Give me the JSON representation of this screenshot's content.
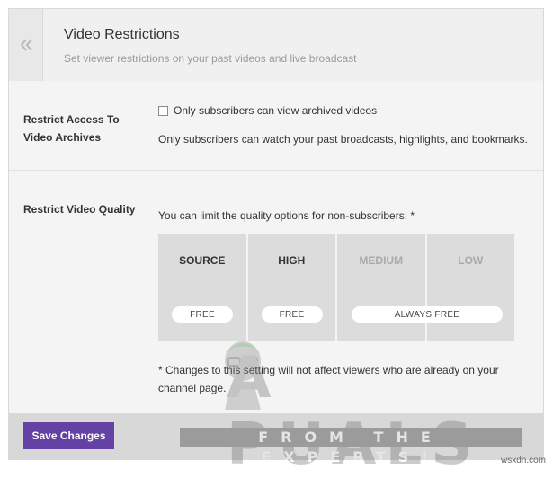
{
  "header": {
    "back_icon": "double-chevron-left-icon",
    "title": "Video Restrictions",
    "subtitle": "Set viewer restrictions on your past videos and live broadcast"
  },
  "archives": {
    "label": "Restrict Access To Video Archives",
    "checkbox_label": "Only subscribers can view archived videos",
    "checked": false,
    "help": "Only subscribers can watch your past broadcasts, highlights, and bookmarks."
  },
  "quality": {
    "label": "Restrict Video Quality",
    "intro": "You can limit the quality options for non-subscribers: *",
    "options": [
      {
        "name": "SOURCE",
        "badge": "FREE",
        "enabled": true
      },
      {
        "name": "HIGH",
        "badge": "FREE",
        "enabled": true
      },
      {
        "name": "MEDIUM",
        "enabled": false
      },
      {
        "name": "LOW",
        "enabled": false
      }
    ],
    "always_free_label": "ALWAYS FREE",
    "note": "* Changes to this setting will not affect viewers who are already on your channel page."
  },
  "footer": {
    "save_label": "Save Changes"
  },
  "watermark": {
    "brand": "A PUALS",
    "tagline": "FROM THE EXPERTS!",
    "site": "wsxdn.com"
  },
  "colors": {
    "accent": "#6441a5",
    "panel_bg": "#f4f4f4",
    "quality_cell": "#dcdcdc"
  }
}
